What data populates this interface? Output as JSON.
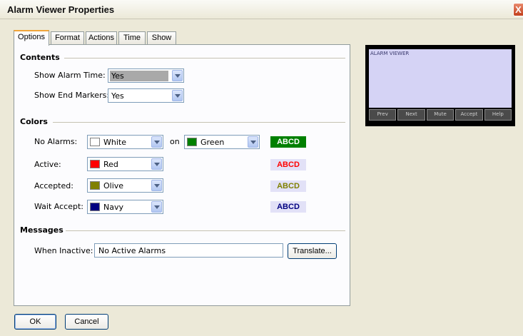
{
  "window": {
    "title": "Alarm Viewer Properties",
    "close_glyph": "X"
  },
  "tabs": [
    {
      "label": "Options",
      "active": true
    },
    {
      "label": "Format",
      "active": false
    },
    {
      "label": "Actions",
      "active": false
    },
    {
      "label": "Time",
      "active": false
    },
    {
      "label": "Show",
      "active": false
    }
  ],
  "contents": {
    "header": "Contents",
    "show_alarm_time": {
      "label": "Show Alarm Time:",
      "value": "Yes"
    },
    "show_end_markers": {
      "label": "Show End Markers:",
      "value": "Yes"
    }
  },
  "colors": {
    "header": "Colors",
    "on_label": "on",
    "preview_text": "ABCD",
    "no_alarms": {
      "label": "No Alarms:",
      "fg_value": "White",
      "fg_hex": "#ffffff",
      "bg_value": "Green",
      "bg_hex": "#008000"
    },
    "active": {
      "label": "Active:",
      "value": "Red",
      "hex": "#ff0000",
      "preview_bg": "#e2e1f7"
    },
    "accepted": {
      "label": "Accepted:",
      "value": "Olive",
      "hex": "#808000",
      "preview_bg": "#e2e1f7"
    },
    "wait_accept": {
      "label": "Wait Accept:",
      "value": "Navy",
      "hex": "#000080",
      "preview_bg": "#e2e1f7"
    }
  },
  "messages": {
    "header": "Messages",
    "when_inactive": {
      "label": "When Inactive:",
      "value": "No Active Alarms"
    },
    "translate_button": "Translate..."
  },
  "buttons": {
    "ok": "OK",
    "cancel": "Cancel"
  },
  "alarm_viewer_preview": {
    "title": "ALARM VIEWER",
    "buttons": [
      "Prev",
      "Next",
      "Mute",
      "Accept",
      "Help"
    ]
  }
}
